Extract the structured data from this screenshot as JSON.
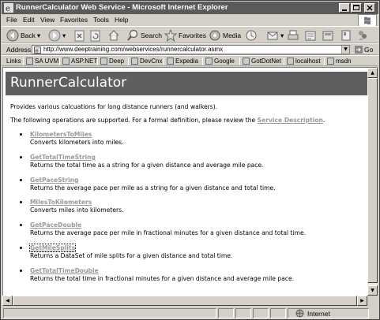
{
  "window": {
    "title": "RunnerCalculator Web Service - Microsoft Internet Explorer"
  },
  "menu": [
    "File",
    "Edit",
    "View",
    "Favorites",
    "Tools",
    "Help"
  ],
  "toolbar": {
    "back": "Back",
    "search": "Search",
    "favorites": "Favorites",
    "media": "Media"
  },
  "address": {
    "label": "Address",
    "url": "http://www.deeptraining.com/webservices/runnercalculator.asmx",
    "go": "Go"
  },
  "links": {
    "label": "Links",
    "items": [
      "SA UVM",
      "ASP.NET",
      "Deep",
      "DevCnx",
      "Expedia",
      "Google",
      "GotDotNet",
      "localhost",
      "msdn"
    ]
  },
  "page": {
    "heading": "RunnerCalculator",
    "intro1": "Provides various calcuations for long distance runners (and walkers).",
    "intro2_prefix": "The following operations are supported. For a formal definition, please review the",
    "intro2_link": "Service Description",
    "intro2_suffix": ".",
    "operations": [
      {
        "name": "KilometersToMiles",
        "desc": "Converts kilometers into miles."
      },
      {
        "name": "GetTotalTimeString",
        "desc": "Returns the total time as a string for a given distance and average mile pace."
      },
      {
        "name": "GetPaceString",
        "desc": "Returns the average pace per mile as a string for a given distance and total time."
      },
      {
        "name": "MilesToKilometers",
        "desc": "Converts miles into kilometers."
      },
      {
        "name": "GetPaceDouble",
        "desc": "Returns the average pace per mile in fractional minutes for a given distance and total time."
      },
      {
        "name": "GetMileSplits",
        "desc": "Returns a DataSet of mile splits for a given distance and total time."
      },
      {
        "name": "GetTotalTimeDouble",
        "desc": "Returns the total time in fractional minutes for a given distance and average mile pace."
      }
    ]
  },
  "status": {
    "zone": "Internet"
  }
}
